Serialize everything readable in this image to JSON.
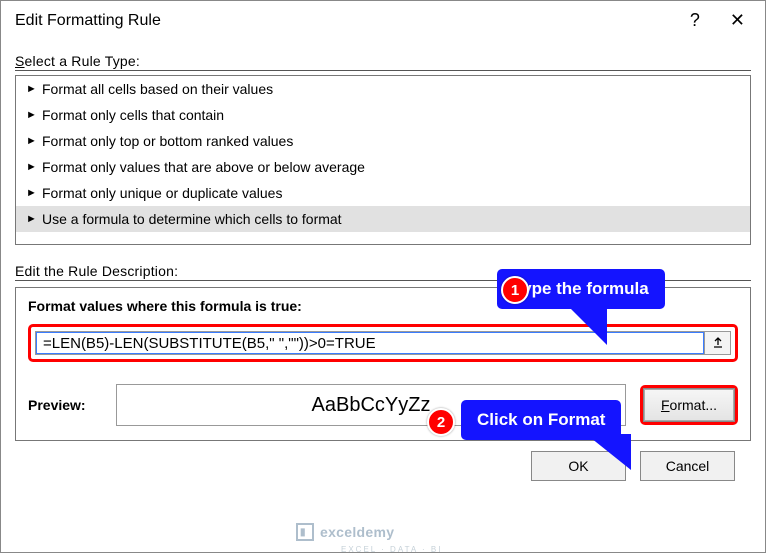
{
  "window": {
    "title": "Edit Formatting Rule",
    "help": "?",
    "close": "✕"
  },
  "ruleType": {
    "label_pre": "S",
    "label_rest": "elect a Rule Type:",
    "items": [
      "Format all cells based on their values",
      "Format only cells that contain",
      "Format only top or bottom ranked values",
      "Format only values that are above or below average",
      "Format only unique or duplicate values",
      "Use a formula to determine which cells to format"
    ],
    "selected_index": 5
  },
  "ruleDesc": {
    "label_full": "Edit the Rule Description:",
    "formula_label": "Format values where this formula is true:",
    "formula_value": "=LEN(B5)-LEN(SUBSTITUTE(B5,\" \",\"\"))>0=TRUE",
    "preview_label": "Preview:",
    "preview_text": "AaBbCcYyZz",
    "format_btn_pre": "F",
    "format_btn_rest": "ormat..."
  },
  "buttons": {
    "ok": "OK",
    "cancel": "Cancel"
  },
  "callouts": {
    "c1": "Type the formula",
    "c2": "Click on Format",
    "n1": "1",
    "n2": "2"
  },
  "watermark": {
    "text": "exceldemy",
    "sub": "EXCEL · DATA · BI"
  },
  "chart_data": null
}
